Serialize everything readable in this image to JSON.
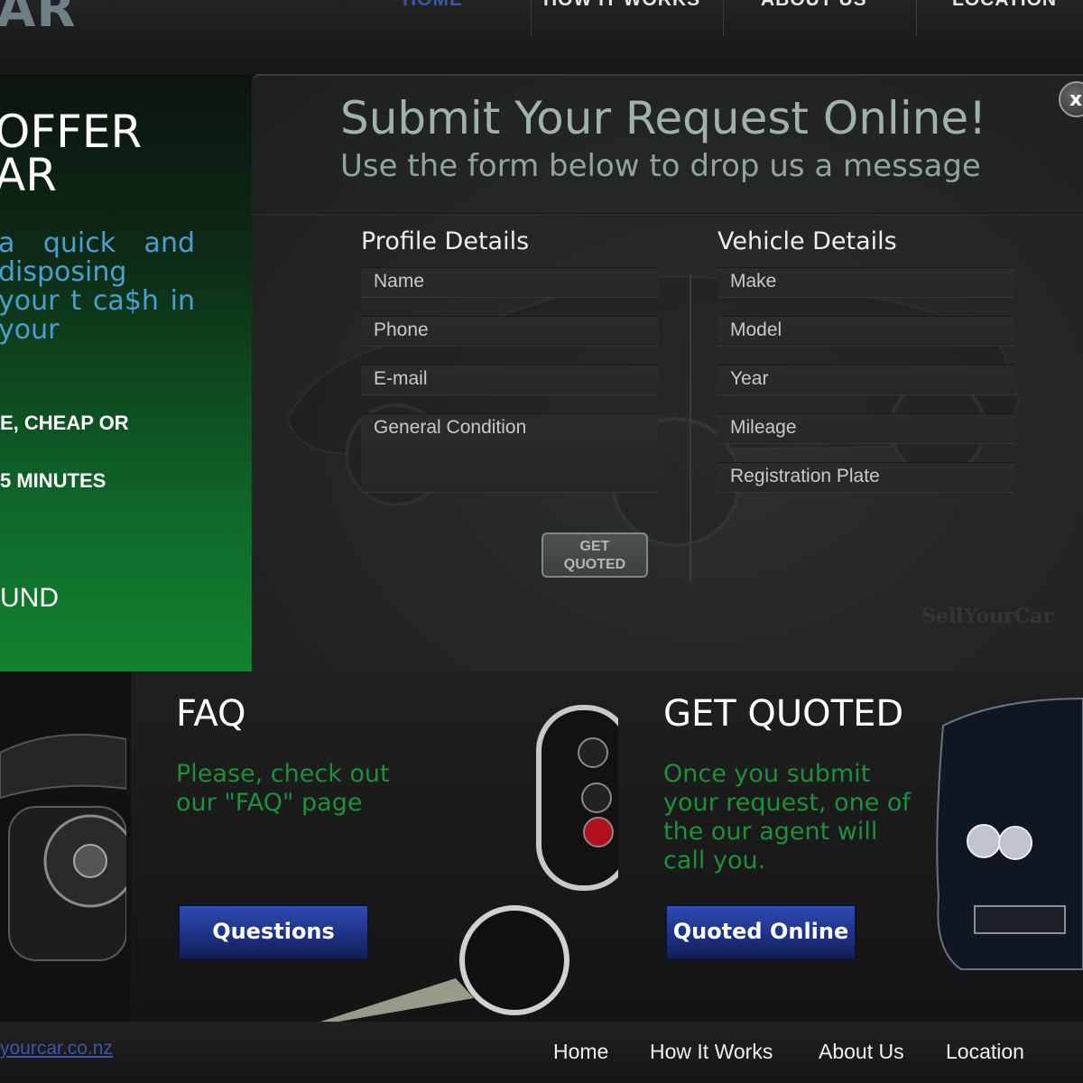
{
  "header": {
    "logo_text": "AR",
    "nav": [
      {
        "label": "HOME",
        "active": true
      },
      {
        "label": "HOW IT WORKS",
        "active": false
      },
      {
        "label": "ABOUT US",
        "active": false
      },
      {
        "label": "LOCATION",
        "active": false
      }
    ]
  },
  "promo": {
    "title_line1": "OFFER",
    "title_line2": "AR",
    "text": "a quick and disposing your t ca$h in your",
    "bullet1": "E, CHEAP OR",
    "bullet2": "5 MINUTES",
    "found": "UND"
  },
  "modal": {
    "title": "Submit Your Request Online!",
    "subtitle": "Use the form below to drop us a message",
    "close_label": "x",
    "profile": {
      "heading": "Profile Details",
      "fields": [
        {
          "placeholder": "Name"
        },
        {
          "placeholder": "Phone"
        },
        {
          "placeholder": "E-mail"
        },
        {
          "placeholder": "General Condition"
        }
      ]
    },
    "vehicle": {
      "heading": "Vehicle Details",
      "fields": [
        {
          "placeholder": "Make"
        },
        {
          "placeholder": "Model"
        },
        {
          "placeholder": "Year"
        },
        {
          "placeholder": "Mileage"
        },
        {
          "placeholder": "Registration Plate"
        }
      ]
    },
    "submit_label_line1": "GET",
    "submit_label_line2": "QUOTED",
    "watermark": "SellYourCar"
  },
  "panels": {
    "faq": {
      "title": "FAQ",
      "text": "Please, check out our \"FAQ\" page",
      "button": "Questions"
    },
    "quote": {
      "title": "GET QUOTED",
      "text": "Once you submit your request, one of the our agent will call you.",
      "button": "Quoted Online"
    }
  },
  "footer": {
    "url": "yourcar.co.nz",
    "links": [
      "Home",
      "How It Works",
      "About Us",
      "Location"
    ]
  },
  "colors": {
    "accent_blue": "#2e4cb4",
    "accent_green": "#1e8f3a",
    "promo_green": "#12822f",
    "nav_active": "#3a57a8"
  }
}
